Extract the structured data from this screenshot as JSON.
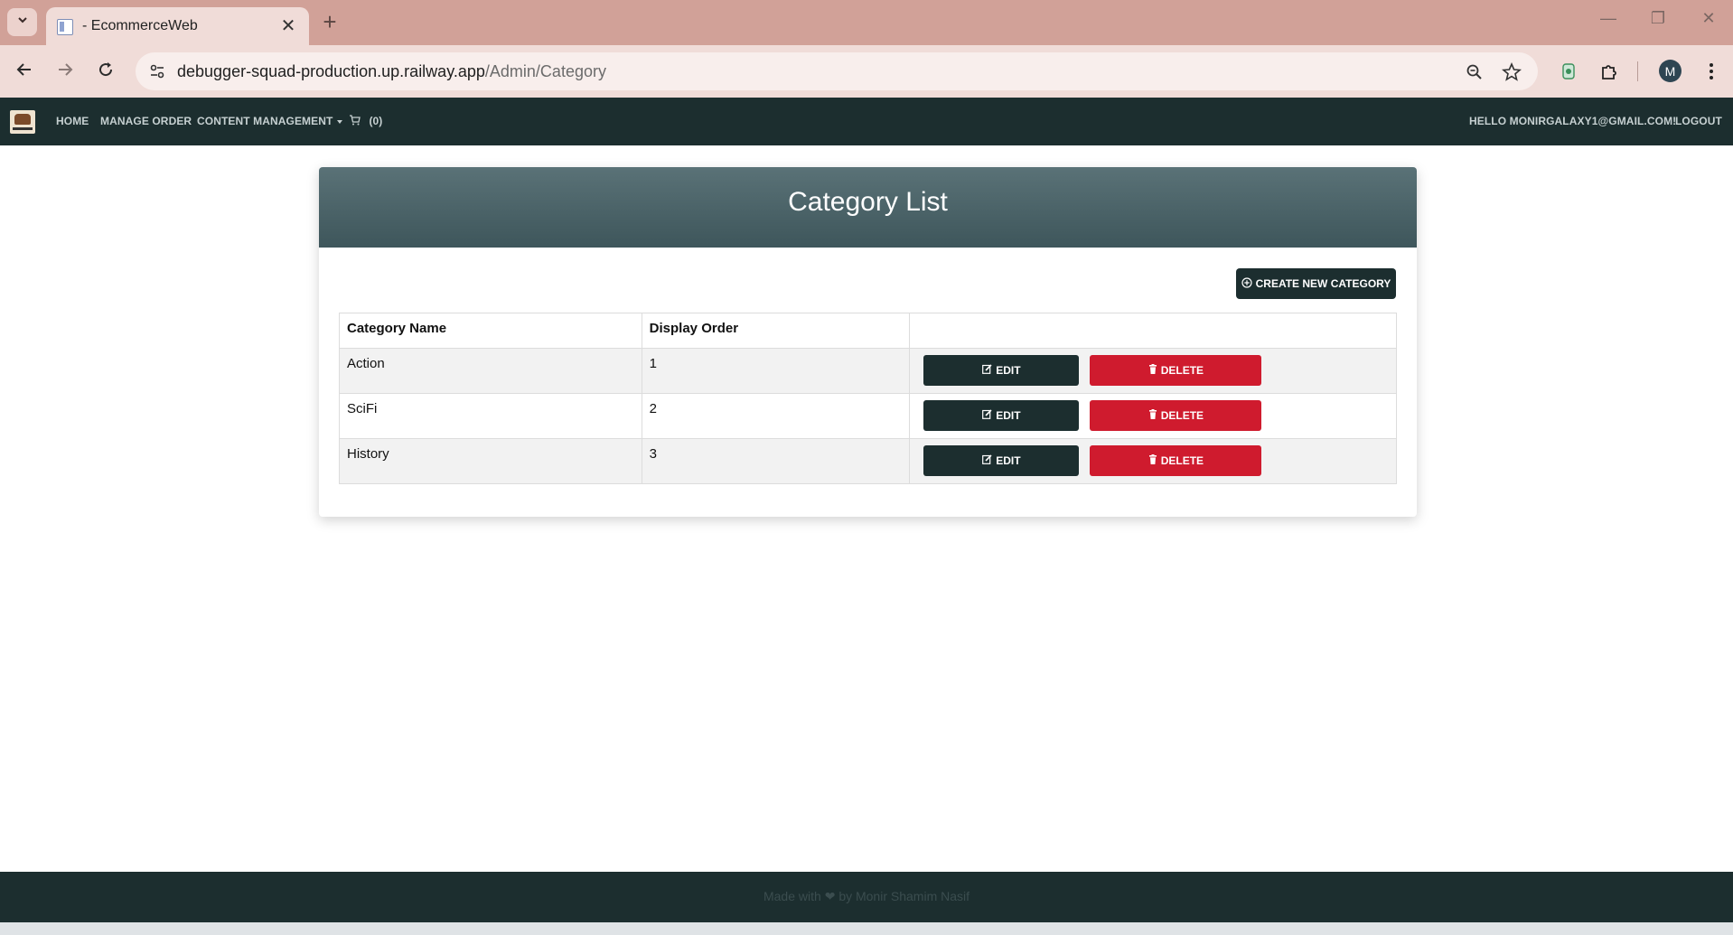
{
  "browser": {
    "tab_title": "- EcommerceWeb",
    "tab_close": "✕",
    "new_tab": "+",
    "url_host": "debugger-squad-production.up.railway.app",
    "url_path": "/Admin/Category",
    "profile_initial": "M",
    "window_controls": {
      "minimize": "—",
      "restore": "❐",
      "close": "✕"
    }
  },
  "navbar": {
    "home": "HOME",
    "manage_order": "MANAGE ORDER",
    "content_management": "CONTENT MANAGEMENT",
    "cart_count": "(0)",
    "greeting": "HELLO MONIRGALAXY1@GMAIL.COM!",
    "logout": "LOGOUT"
  },
  "page": {
    "title": "Category List",
    "create_button": "CREATE NEW CATEGORY"
  },
  "table": {
    "headers": {
      "name": "Category Name",
      "order": "Display Order"
    },
    "rows": [
      {
        "name": "Action",
        "order": "1"
      },
      {
        "name": "SciFi",
        "order": "2"
      },
      {
        "name": "History",
        "order": "3"
      }
    ],
    "edit_label": "EDIT",
    "delete_label": "DELETE"
  },
  "footer": {
    "made_with": "Made with",
    "by": "by Monir Shamim Nasif"
  },
  "colors": {
    "navbar_bg": "#1c2e2f",
    "delete_red": "#cf1b2e",
    "header_teal": "#4a6368",
    "chrome_tab_strip": "#d1a198"
  },
  "icons": [
    "chevron-down-icon",
    "page-favicon-icon",
    "close-icon",
    "plus-icon",
    "back-arrow-icon",
    "forward-arrow-icon",
    "reload-icon",
    "site-info-icon",
    "zoom-icon",
    "star-icon",
    "extension-doc-icon",
    "puzzle-icon",
    "more-vert-icon",
    "cart-icon",
    "plus-circle-icon",
    "edit-icon",
    "trash-icon",
    "heart-icon"
  ]
}
